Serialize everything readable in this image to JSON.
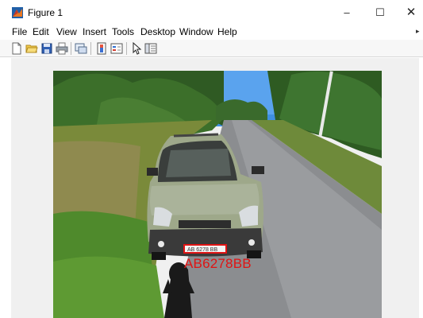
{
  "window": {
    "title": "Figure 1",
    "controls": {
      "minimize": "–",
      "maximize": "☐",
      "close": "✕"
    }
  },
  "menu": {
    "items": [
      "File",
      "Edit",
      "View",
      "Insert",
      "Tools",
      "Desktop",
      "Window",
      "Help"
    ]
  },
  "toolbar": {
    "icons": [
      "new-figure-icon",
      "open-file-icon",
      "save-icon",
      "print-icon",
      "link-plot-icon",
      "insert-colorbar-icon",
      "insert-legend-icon",
      "edit-plot-arrow-icon",
      "property-inspector-icon"
    ]
  },
  "figure": {
    "detected_plate_text": "AB6278BB",
    "plate_physical_text": "AB 6278 BB",
    "annotation_color": "#e01414"
  }
}
